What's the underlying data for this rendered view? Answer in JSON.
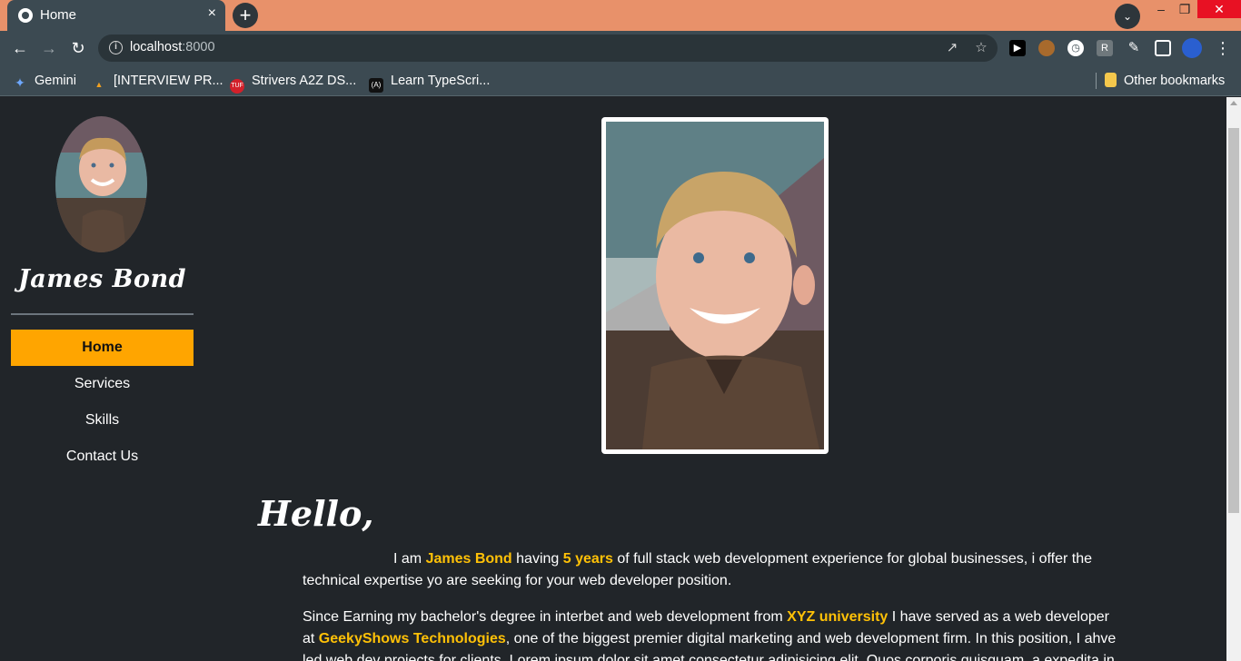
{
  "browser": {
    "tab_title": "Home",
    "tab_close": "×",
    "new_tab": "+",
    "url_host": "localhost",
    "url_port": ":8000",
    "other_bookmarks": "Other bookmarks",
    "bookmarks": [
      {
        "label": "Gemini",
        "icon": "gemini-icon"
      },
      {
        "label": "[INTERVIEW PR...",
        "icon": "interview-icon"
      },
      {
        "label": "Strivers A2Z DS...",
        "icon": "tuf-icon"
      },
      {
        "label": "Learn TypeScri...",
        "icon": "typescript-icon"
      }
    ]
  },
  "sidebar": {
    "name": "James Bond",
    "menu": [
      {
        "label": "Home",
        "active": true
      },
      {
        "label": "Services"
      },
      {
        "label": "Skills"
      },
      {
        "label": "Contact Us"
      }
    ]
  },
  "main": {
    "greeting": "Hello,",
    "p1": {
      "a": "I am ",
      "name": "James Bond",
      "b": " having ",
      "years": "5 years",
      "c": " of full stack web development experience for global businesses, i offer the technical expertise yo are seeking for your web developer position."
    },
    "p2": {
      "a": "Since Earning my bachelor's degree in interbet and web development from ",
      "uni": "XYZ university",
      "b": " I have served as a web developer at ",
      "company": "GeekyShows Technologies",
      "c": ", one of the biggest premier digital marketing and web development firm. In this position, I ahve led web dev projects for clients. Lorem ipsum dolor sit amet consectetur adipisicing elit. Quos corporis quisquam, a expedita in"
    }
  },
  "colors": {
    "accent": "#ffa500",
    "highlight": "#ffc107",
    "page_bg": "#212529",
    "tab_strip": "#e8916a",
    "chrome": "#3c4a52"
  }
}
